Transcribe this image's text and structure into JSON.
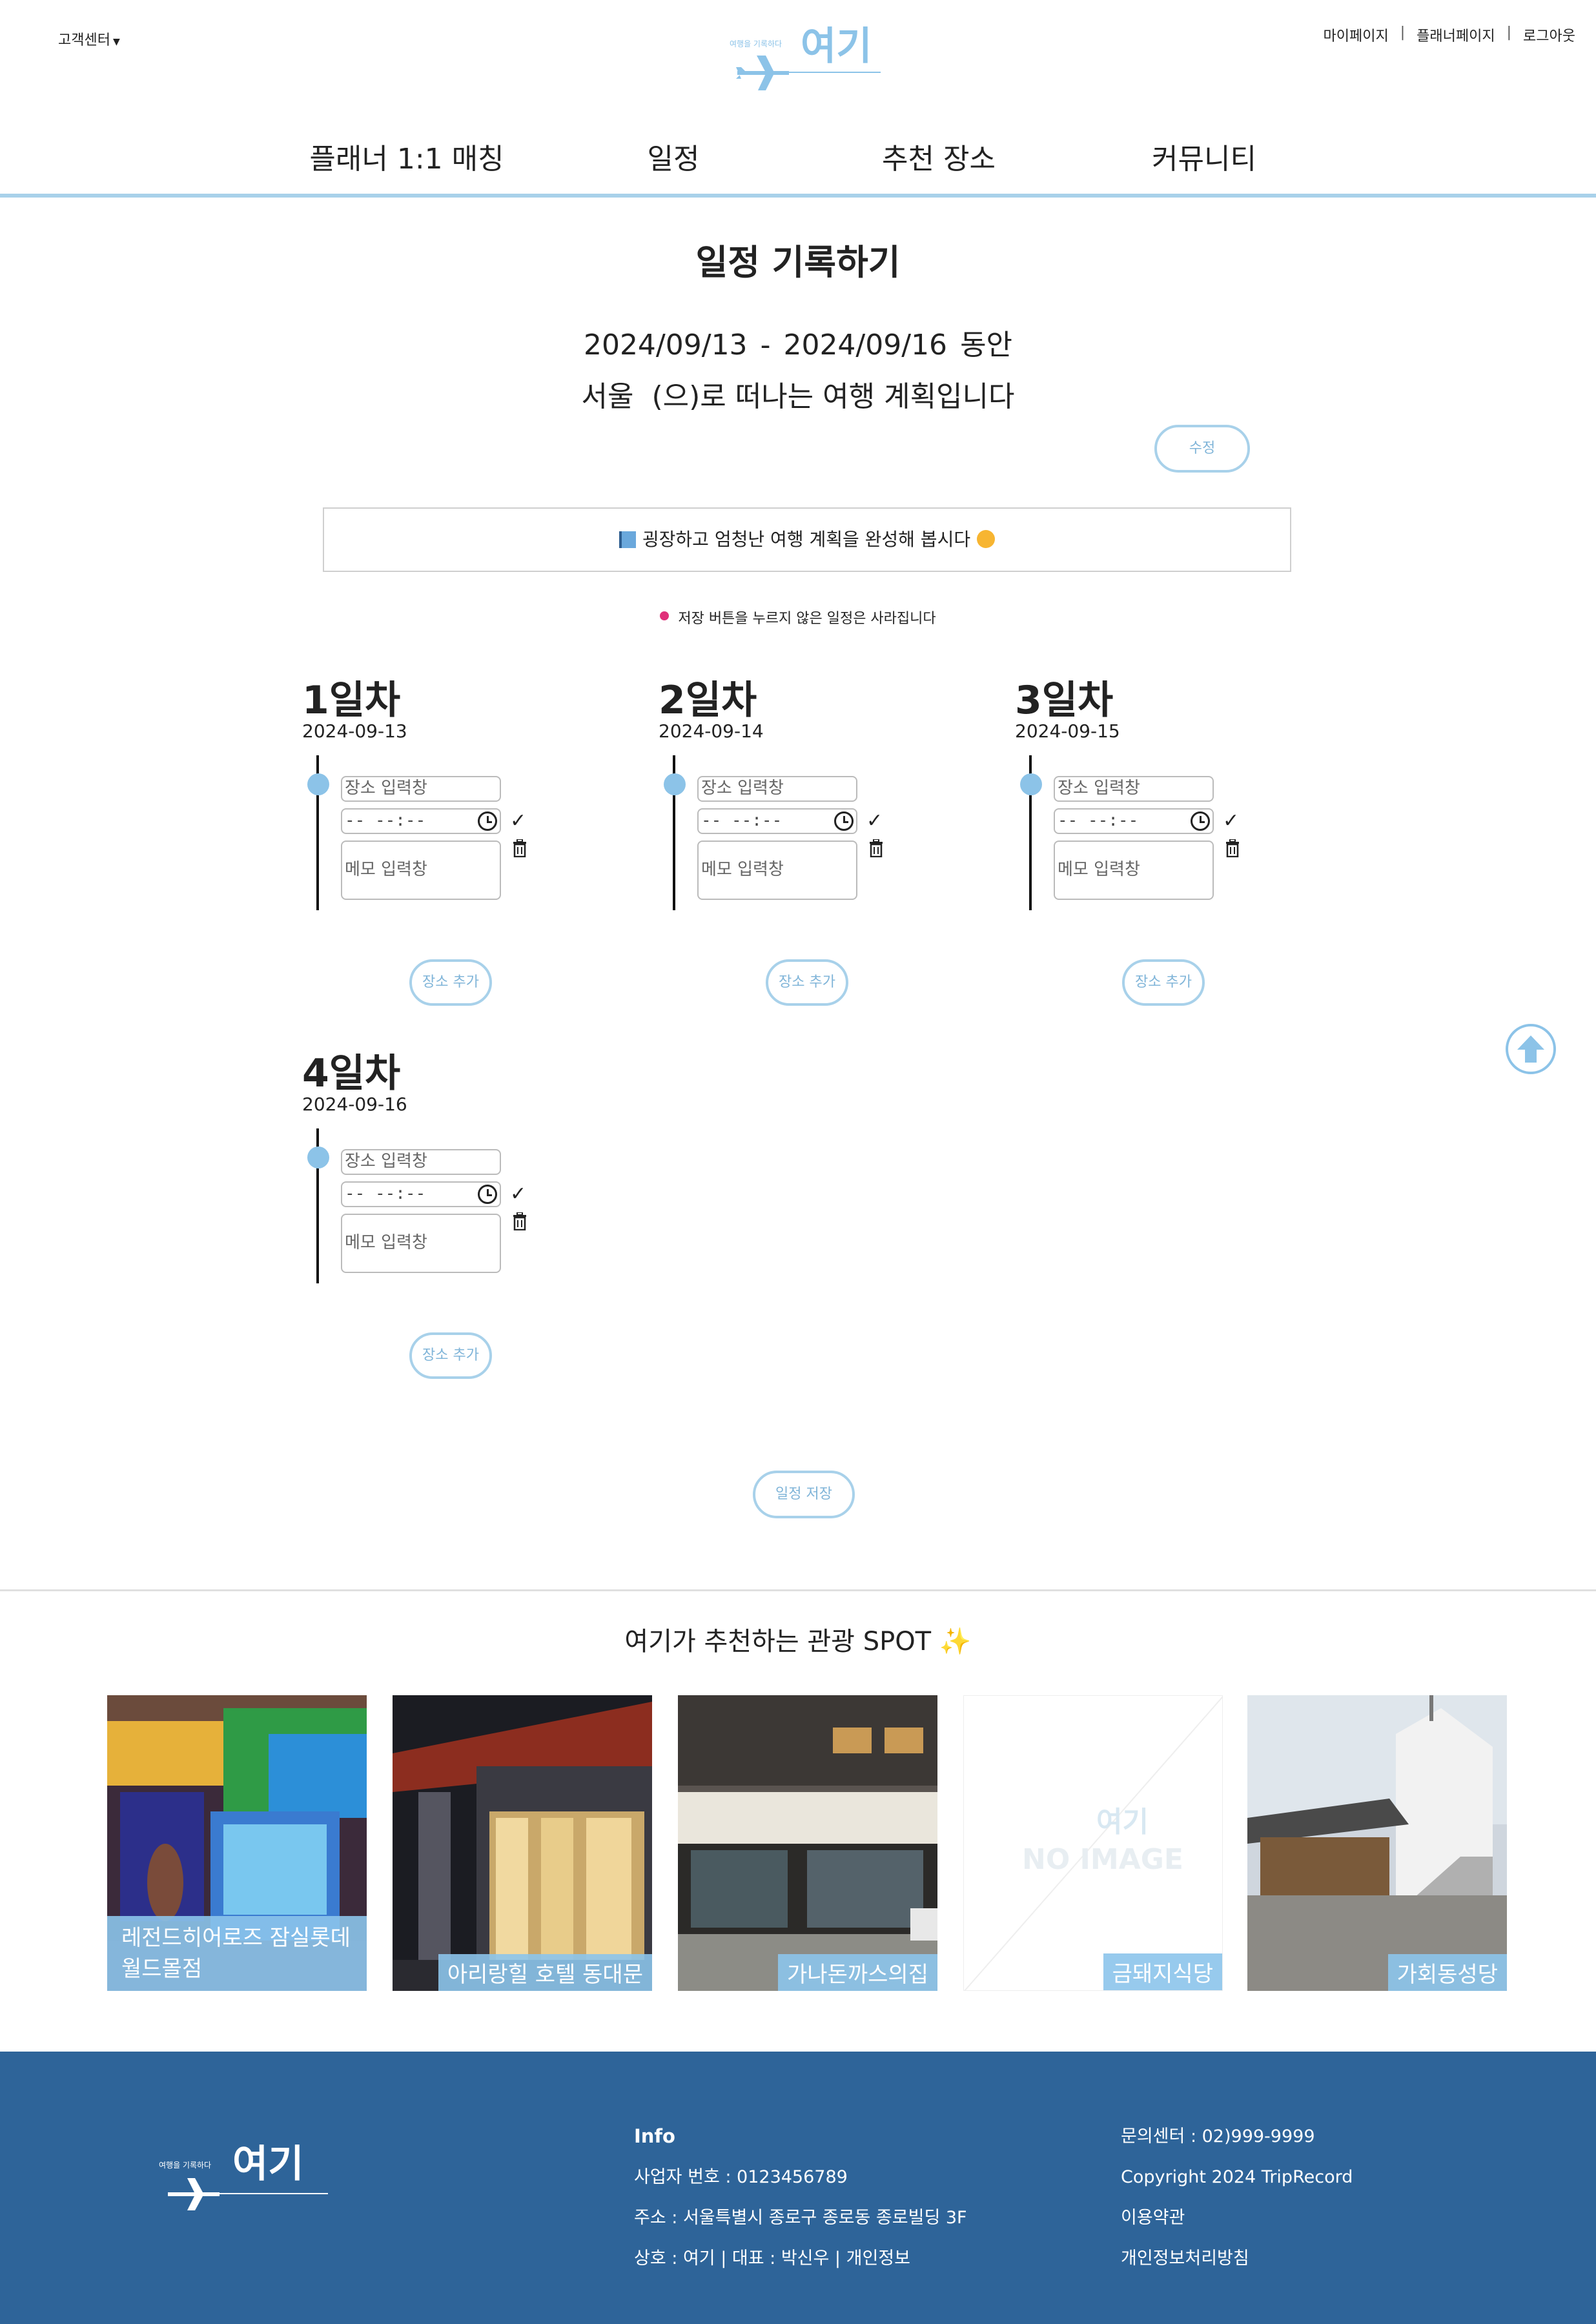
{
  "header": {
    "customer_center": "고객센터",
    "logo_tagline": "여행을 기록하다",
    "logo_text": "여기",
    "links": [
      "마이페이지",
      "플래너페이지",
      "로그아웃"
    ],
    "separator": "|"
  },
  "nav": {
    "items": [
      "플래너 1:1 매칭",
      "일정",
      "추천 장소",
      "커뮤니티"
    ]
  },
  "plan": {
    "title": "일정 기록하기",
    "start_date": "2024/09/13",
    "dash": "-",
    "end_date": "2024/09/16",
    "during": "동안",
    "destination": "서울",
    "destination_suffix": "(으)로 떠나는 여행 계획입니다",
    "edit_button": "수정",
    "banner_text": "굉장하고 엄청난 여행 계획을 완성해 봅시다",
    "warning_text": "저장 버튼을 누르지 않은 일정은 사라집니다",
    "save_button": "일정 저장"
  },
  "days": [
    {
      "title": "1일차",
      "date": "2024-09-13",
      "place_placeholder": "장소 입력창",
      "time_value": "-- --:--",
      "memo_placeholder": "메모 입력창",
      "add_button": "장소 추가"
    },
    {
      "title": "2일차",
      "date": "2024-09-14",
      "place_placeholder": "장소 입력창",
      "time_value": "-- --:--",
      "memo_placeholder": "메모 입력창",
      "add_button": "장소 추가"
    },
    {
      "title": "3일차",
      "date": "2024-09-15",
      "place_placeholder": "장소 입력창",
      "time_value": "-- --:--",
      "memo_placeholder": "메모 입력창",
      "add_button": "장소 추가"
    },
    {
      "title": "4일차",
      "date": "2024-09-16",
      "place_placeholder": "장소 입력창",
      "time_value": "-- --:--",
      "memo_placeholder": "메모 입력창",
      "add_button": "장소 추가"
    }
  ],
  "recommend": {
    "title": "여기가 추천하는 관광 SPOT",
    "sparkle": "✨",
    "spots": [
      {
        "name_line1": "레전드히어로즈 잠실롯데",
        "name_line2": "월드몰점"
      },
      {
        "name": "아리랑힐 호텔 동대문"
      },
      {
        "name": "가나돈까스의집"
      },
      {
        "name": "금돼지식당",
        "no_image": "NO IMAGE",
        "no_image_logo": "여기"
      },
      {
        "name": "가회동성당"
      }
    ]
  },
  "footer": {
    "logo_tagline": "여행을 기록하다",
    "logo_text": "여기",
    "info_heading": "Info",
    "business_no": "사업자 번호 : 0123456789",
    "address": "주소 : 서울특별시 종로구 종로동 종로빌딩 3F",
    "company": "상호 : 여기 | 대표 : 박신우 | 개인정보",
    "contact": "문의센터 : 02)999-9999",
    "copyright": "Copyright 2024 TripRecord",
    "terms": "이용약관",
    "privacy": "개인정보처리방침"
  },
  "colors": {
    "accent": "#a8d1ea",
    "timeline_dot": "#8cc3e8",
    "footer_bg": "#2e6499"
  }
}
